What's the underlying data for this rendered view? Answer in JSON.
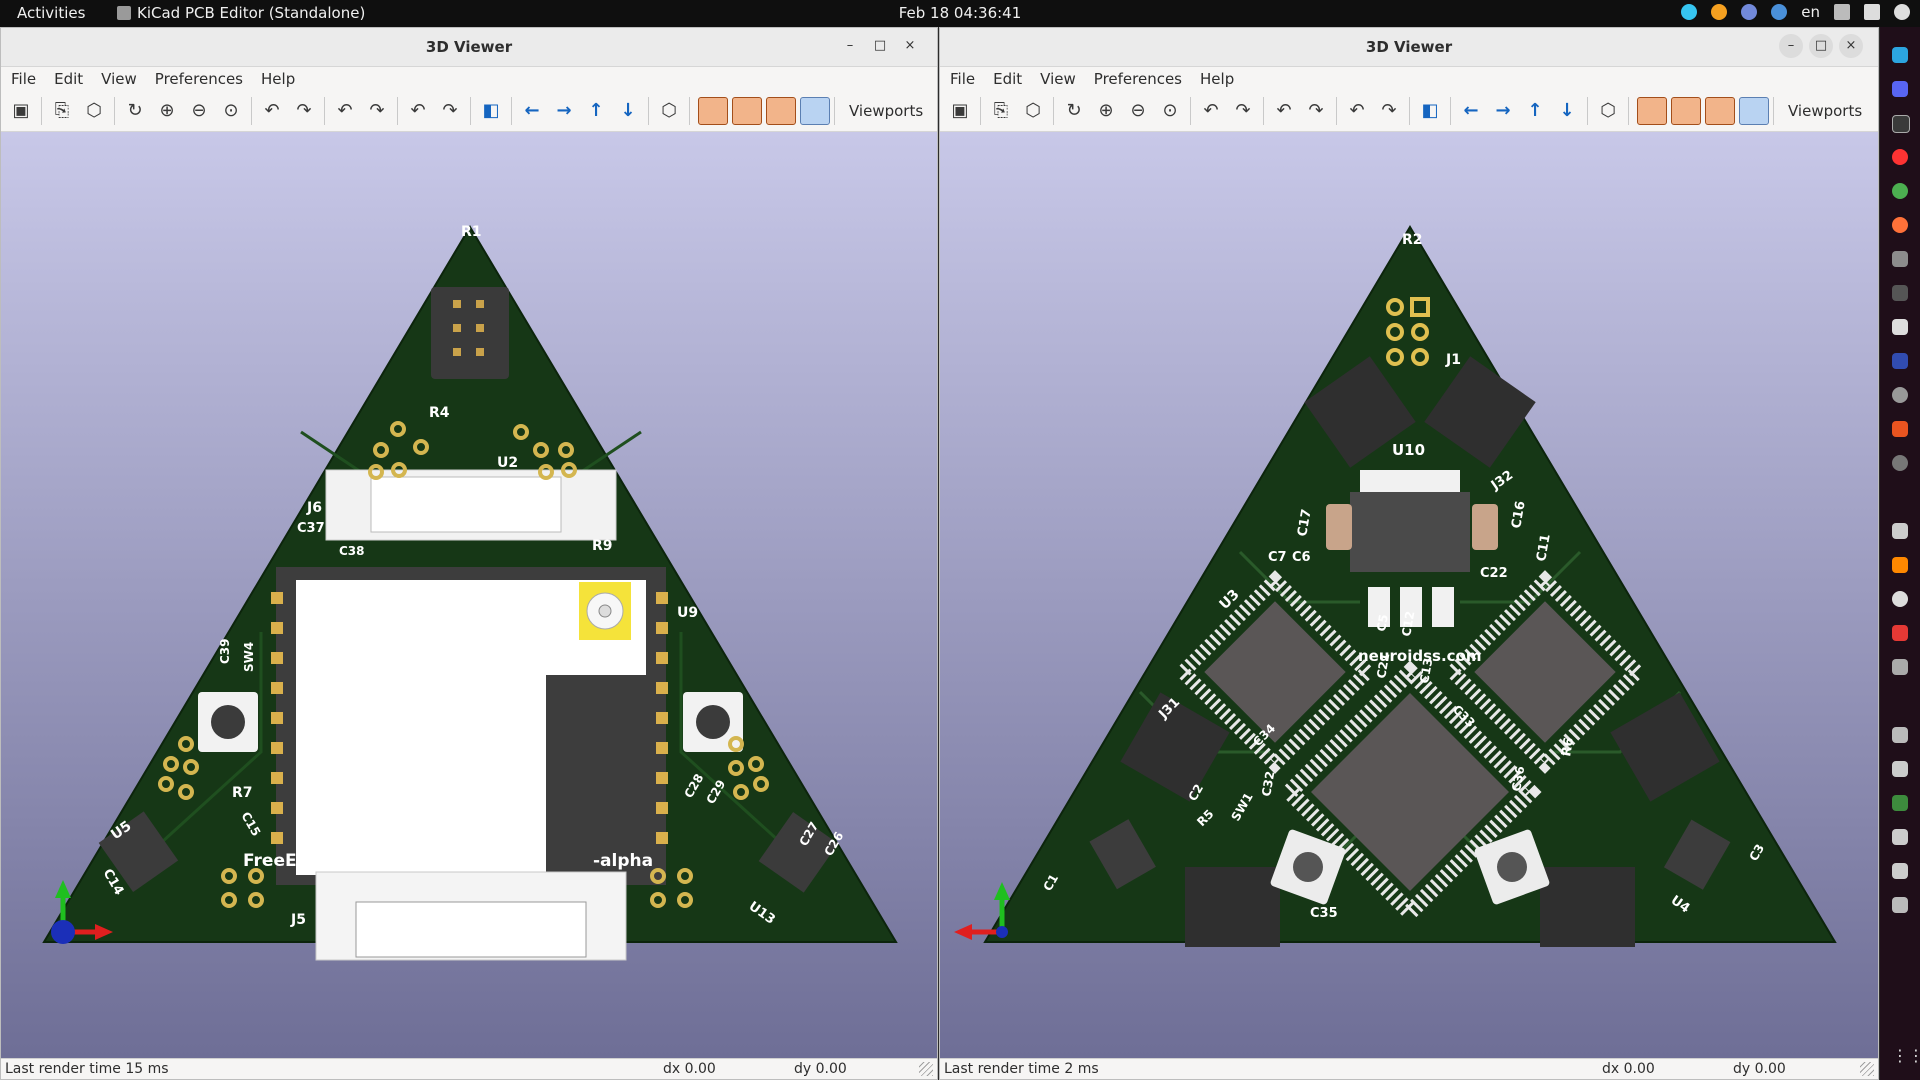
{
  "topbar": {
    "activities": "Activities",
    "app_name": "KiCad PCB Editor (Standalone)",
    "datetime": "Feb 18  04:36:41",
    "language": "en"
  },
  "windows": [
    {
      "title": "3D Viewer",
      "menu": [
        "File",
        "Edit",
        "View",
        "Preferences",
        "Help"
      ],
      "viewports_label": "Viewports",
      "status": {
        "render": "Last render time 15 ms",
        "dx": "dx 0.00",
        "dy": "dy 0.00"
      },
      "board_labels": [
        "R1",
        "R4",
        "U2",
        "J6",
        "C37",
        "C38",
        "R9",
        "U9",
        "C39",
        "SW4",
        "R7",
        "C15",
        "U5",
        "C14",
        "FreeEEG16",
        "alpha",
        "J5",
        "C28",
        "C29",
        "C27",
        "C26",
        "U13"
      ]
    },
    {
      "title": "3D Viewer",
      "menu": [
        "File",
        "Edit",
        "View",
        "Preferences",
        "Help"
      ],
      "viewports_label": "Viewports",
      "status": {
        "render": "Last render time 2 ms",
        "dx": "dx 0.00",
        "dy": "dy 0.00"
      },
      "board_labels": [
        "R2",
        "J1",
        "U10",
        "J32",
        "C17",
        "C16",
        "C11",
        "C7",
        "C6",
        "C22",
        "U3",
        "C5",
        "C12",
        "neuroidss.com",
        "C21",
        "C13",
        "J31",
        "C33",
        "C34",
        "R6",
        "C32",
        "C36",
        "C2",
        "R5",
        "SW1",
        "C1",
        "C3",
        "C35",
        "U4"
      ]
    }
  ],
  "icons": {
    "toolbar": [
      "render-icon",
      "copy-icon",
      "board-icon",
      "reload-icon",
      "zoom-in-icon",
      "zoom-out-icon",
      "zoom-fit-icon",
      "rotate-x-cw-icon",
      "rotate-x-ccw-icon",
      "rotate-y-cw-icon",
      "rotate-y-ccw-icon",
      "rotate-z-cw-icon",
      "rotate-z-ccw-icon",
      "flip-icon",
      "arrow-left-icon",
      "arrow-right-icon",
      "arrow-up-icon",
      "arrow-down-icon",
      "ortho-icon",
      "render-tht-icon",
      "render-smd-icon",
      "render-virtual-icon",
      "render-pos-icon"
    ]
  }
}
